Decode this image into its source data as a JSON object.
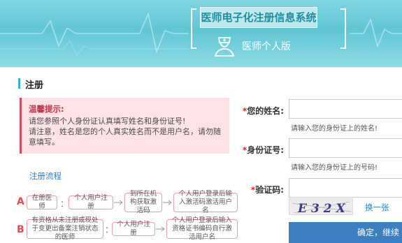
{
  "banner": {
    "title": "医师电子化注册信息系统",
    "subtitle": "医师个人版"
  },
  "section": {
    "title": "注册"
  },
  "tip": {
    "title": "温馨提示:",
    "line1": "请您参照个人身份证认真填写姓名和身份证号!",
    "line2": "请注意，姓名是您的个人真实姓名而不是用户名，请勿随",
    "line3": "意填写。"
  },
  "flow": {
    "link": "注册流程",
    "a": {
      "letter": "A",
      "step1": "在册医师",
      "sep1": "：",
      "step2": "个人用户注册",
      "step3": "到所在机构获取激活码",
      "step4": "个人用户登录后输入激活码激活用户名"
    },
    "b": {
      "letter": "B",
      "step1": "有资格从未注册或现处于变更出备案注销状态的医师",
      "sep1": "：",
      "step2": "个人用户注册",
      "step3": "个人用户登录后输入资格证书编码自行激活用户名"
    }
  },
  "form": {
    "name_label": "您的姓名:",
    "name_hint": "请输入您的身份证上的姓名!",
    "id_label": "身份证号:",
    "id_hint": "请输入您的身份证上的号码!",
    "captcha_label": "验证码:",
    "captcha_text": "E32X",
    "swap_label": "换一张",
    "submit_label": "确定，继续",
    "required_mark": "*"
  },
  "colors": {
    "banner": "#5fc6d4",
    "accent": "#32b6c8",
    "tip_bg": "#fde3e6",
    "tip_border": "#d84a55",
    "button": "#3b7fc1",
    "link": "#2f7fc0"
  }
}
